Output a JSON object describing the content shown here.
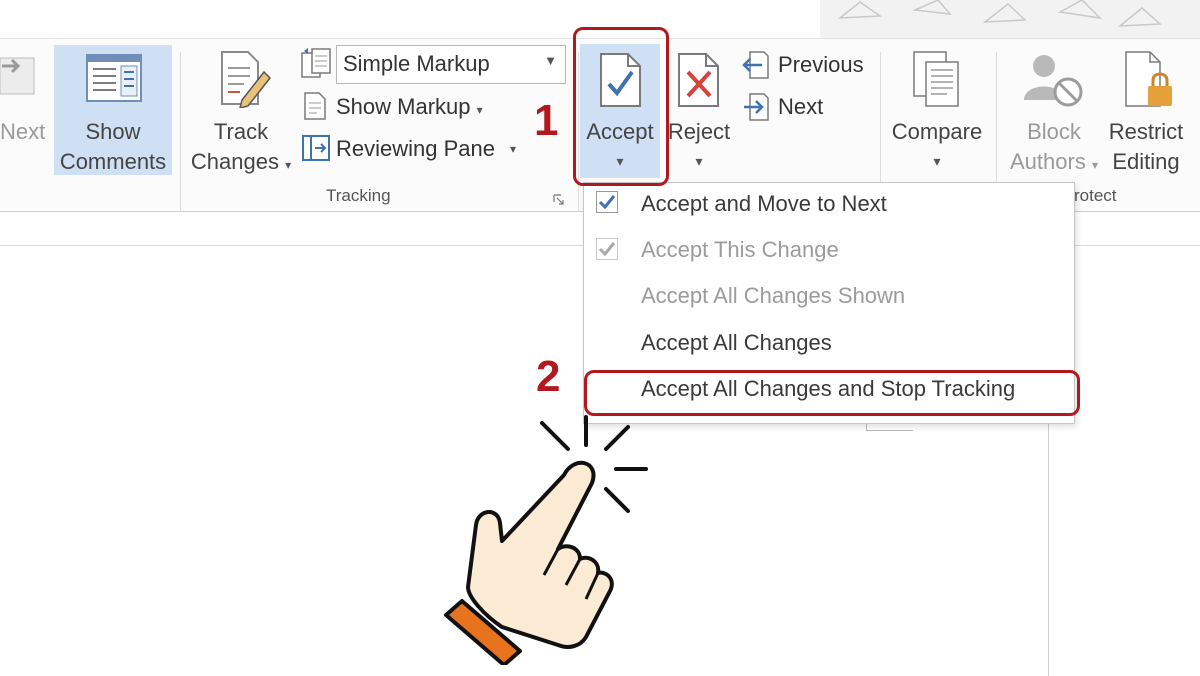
{
  "ribbon": {
    "partial_left_button": "Next",
    "show_comments": {
      "line1": "Show",
      "line2": "Comments"
    },
    "track_changes": {
      "line1": "Track",
      "line2": "Changes"
    },
    "markup_select": {
      "value": "Simple Markup"
    },
    "show_markup": "Show Markup",
    "reviewing_pane": "Reviewing Pane",
    "tracking_group": "Tracking",
    "accept": "Accept",
    "reject": "Reject",
    "previous": "Previous",
    "next": "Next",
    "compare": "Compare",
    "block_authors": {
      "line1": "Block",
      "line2": "Authors"
    },
    "restrict_editing": {
      "line1": "Restrict",
      "line2": "Editing"
    },
    "protect_group_partial": "rotect"
  },
  "accept_menu": {
    "items": [
      {
        "label": "Accept and Move to Next",
        "enabled": true
      },
      {
        "label": "Accept This Change",
        "enabled": false
      },
      {
        "label": "Accept All Changes Shown",
        "enabled": false
      },
      {
        "label": "Accept All Changes",
        "enabled": true
      },
      {
        "label": "Accept All Changes and Stop Tracking",
        "enabled": true
      }
    ]
  },
  "annotations": {
    "step1": "1",
    "step2": "2",
    "highlight_color": "#b1191f"
  },
  "colors": {
    "selected_bg": "#cfe0f4",
    "icon_blue": "#3f72b5",
    "reject_red": "#d9413a",
    "hand_fill": "#fbead4",
    "cuff_orange": "#e8731e"
  }
}
